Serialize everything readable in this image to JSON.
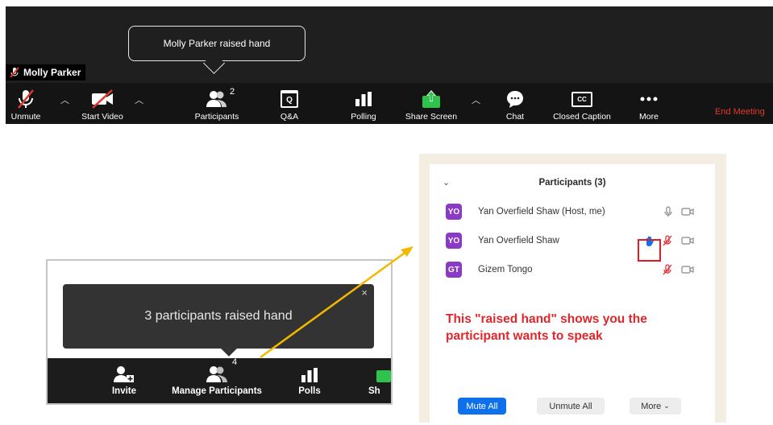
{
  "top_toolbar": {
    "tooltip": "Molly Parker raised hand",
    "name_badge": "Molly Parker",
    "participants_count": "2",
    "buttons": [
      {
        "label": "Unmute",
        "icon": "mic-muted-icon"
      },
      {
        "label": "Start Video",
        "icon": "video-off-icon"
      },
      {
        "label": "Participants",
        "icon": "participants-icon"
      },
      {
        "label": "Q&A",
        "icon": "qa-icon"
      },
      {
        "label": "Polling",
        "icon": "polling-icon"
      },
      {
        "label": "Share Screen",
        "icon": "share-screen-icon"
      },
      {
        "label": "Chat",
        "icon": "chat-icon"
      },
      {
        "label": "Closed Caption",
        "icon": "cc-icon"
      },
      {
        "label": "More",
        "icon": "more-icon"
      }
    ],
    "end_meeting": "End Meeting",
    "qa_glyph": "Q",
    "cc_glyph": "CC",
    "colors": {
      "end_meeting": "#e0382c",
      "share_green": "#2fc24c"
    }
  },
  "bottom_toolbar": {
    "tooltip": "3 participants raised hand",
    "close": "×",
    "participants_count": "4",
    "buttons": [
      {
        "label": "Invite",
        "icon": "invite-icon"
      },
      {
        "label": "Manage Participants",
        "icon": "participants-icon"
      },
      {
        "label": "Polls",
        "icon": "polls-icon"
      },
      {
        "label": "Sh",
        "icon": "share-icon"
      }
    ]
  },
  "participants_panel": {
    "title": "Participants (3)",
    "participants": [
      {
        "initials": "YO",
        "name": "Yan Overfield Shaw (Host, me)",
        "raised_hand": false,
        "mic": "on",
        "video": "off"
      },
      {
        "initials": "YO",
        "name": "Yan Overfield Shaw",
        "raised_hand": true,
        "mic": "muted",
        "video": "off"
      },
      {
        "initials": "GT",
        "name": "Gizem Tongo",
        "raised_hand": false,
        "mic": "muted",
        "video": "off"
      }
    ],
    "annotation": "This \"raised hand\" shows you the participant wants to speak",
    "footer": {
      "mute_all": "Mute All",
      "unmute_all": "Unmute All",
      "more": "More"
    },
    "colors": {
      "avatar": "#8b39c7",
      "annotation": "#e0262a",
      "mute_all_bg": "#0e71eb",
      "hand": "#0e71eb"
    }
  }
}
